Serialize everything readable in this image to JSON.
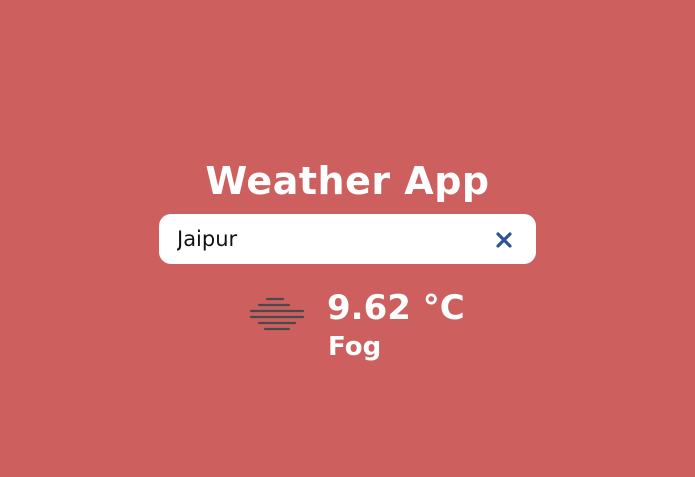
{
  "app": {
    "title": "Weather App"
  },
  "search": {
    "value": "Jaipur",
    "clear_icon": "close-icon"
  },
  "weather": {
    "icon": "fog-icon",
    "temperature": "9.62 °C",
    "condition": "Fog"
  },
  "colors": {
    "background": "#cd5f5f",
    "text": "#ffffff",
    "clear_icon": "#2f5496",
    "fog_icon": "#4a4a4a"
  }
}
